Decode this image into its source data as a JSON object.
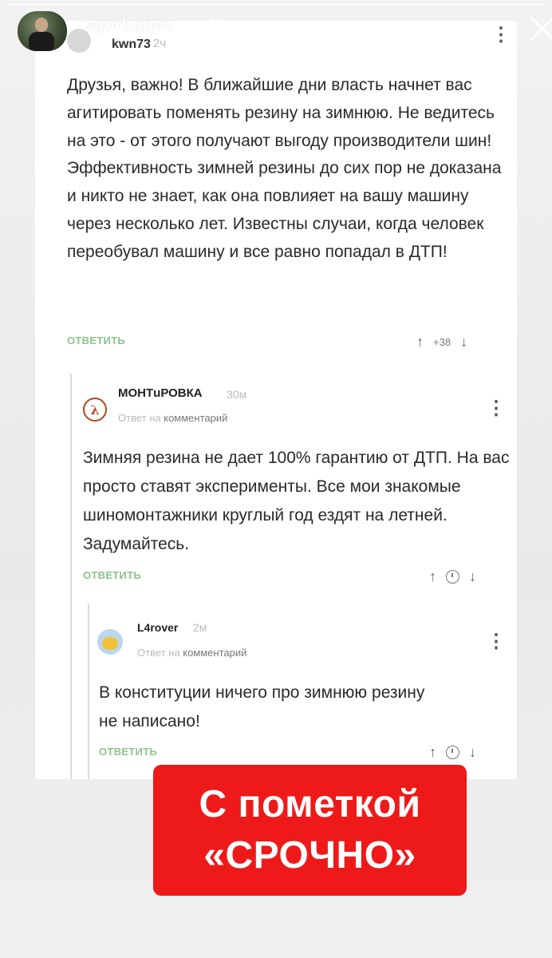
{
  "story": {
    "username": "sgorbunov",
    "time": "20ч.",
    "more_icon": "more-horizontal-icon",
    "close_icon": "close-icon",
    "progress": 1.0
  },
  "comments": [
    {
      "user": "kwn73",
      "time": "2ч",
      "text": "Друзья, важно! В ближайшие дни власть начнет вас агитировать поменять резину на зимнюю. Не ведитесь на это - от этого получают выгоду производители шин! Эффективность зимней резины до сих пор не доказана и никто не знает, как она повлияет на вашу машину через несколько лет. Известны случаи, когда человек переобувал машину и все равно попадал в ДТП!",
      "reply": "ОТВЕТИТЬ",
      "score": "+38"
    },
    {
      "user": "МОНТuРОВКА",
      "time": "30м",
      "reply_to_prefix": "Ответ на",
      "reply_to": "комментарий",
      "text": "Зимняя резина не дает 100% гарантию от ДТП. На вас просто ставят эксперименты. Все мои знакомые шиномонтажники круглый год ездят на летней. Задумайтесь.",
      "reply": "ОТВЕТИТЬ"
    },
    {
      "user": "L4rover",
      "time": "2м",
      "reply_to_prefix": "Ответ на",
      "reply_to": "комментарий",
      "text": "В конституции ничего про зимнюю резину не написано!",
      "reply": "ОТВЕТИТЬ"
    }
  ],
  "banner": {
    "line1": "С пометкой",
    "line2": "«СРОЧНО»",
    "color": "#ee1a1a"
  },
  "colors": {
    "reply_green": "#8bc48a"
  }
}
